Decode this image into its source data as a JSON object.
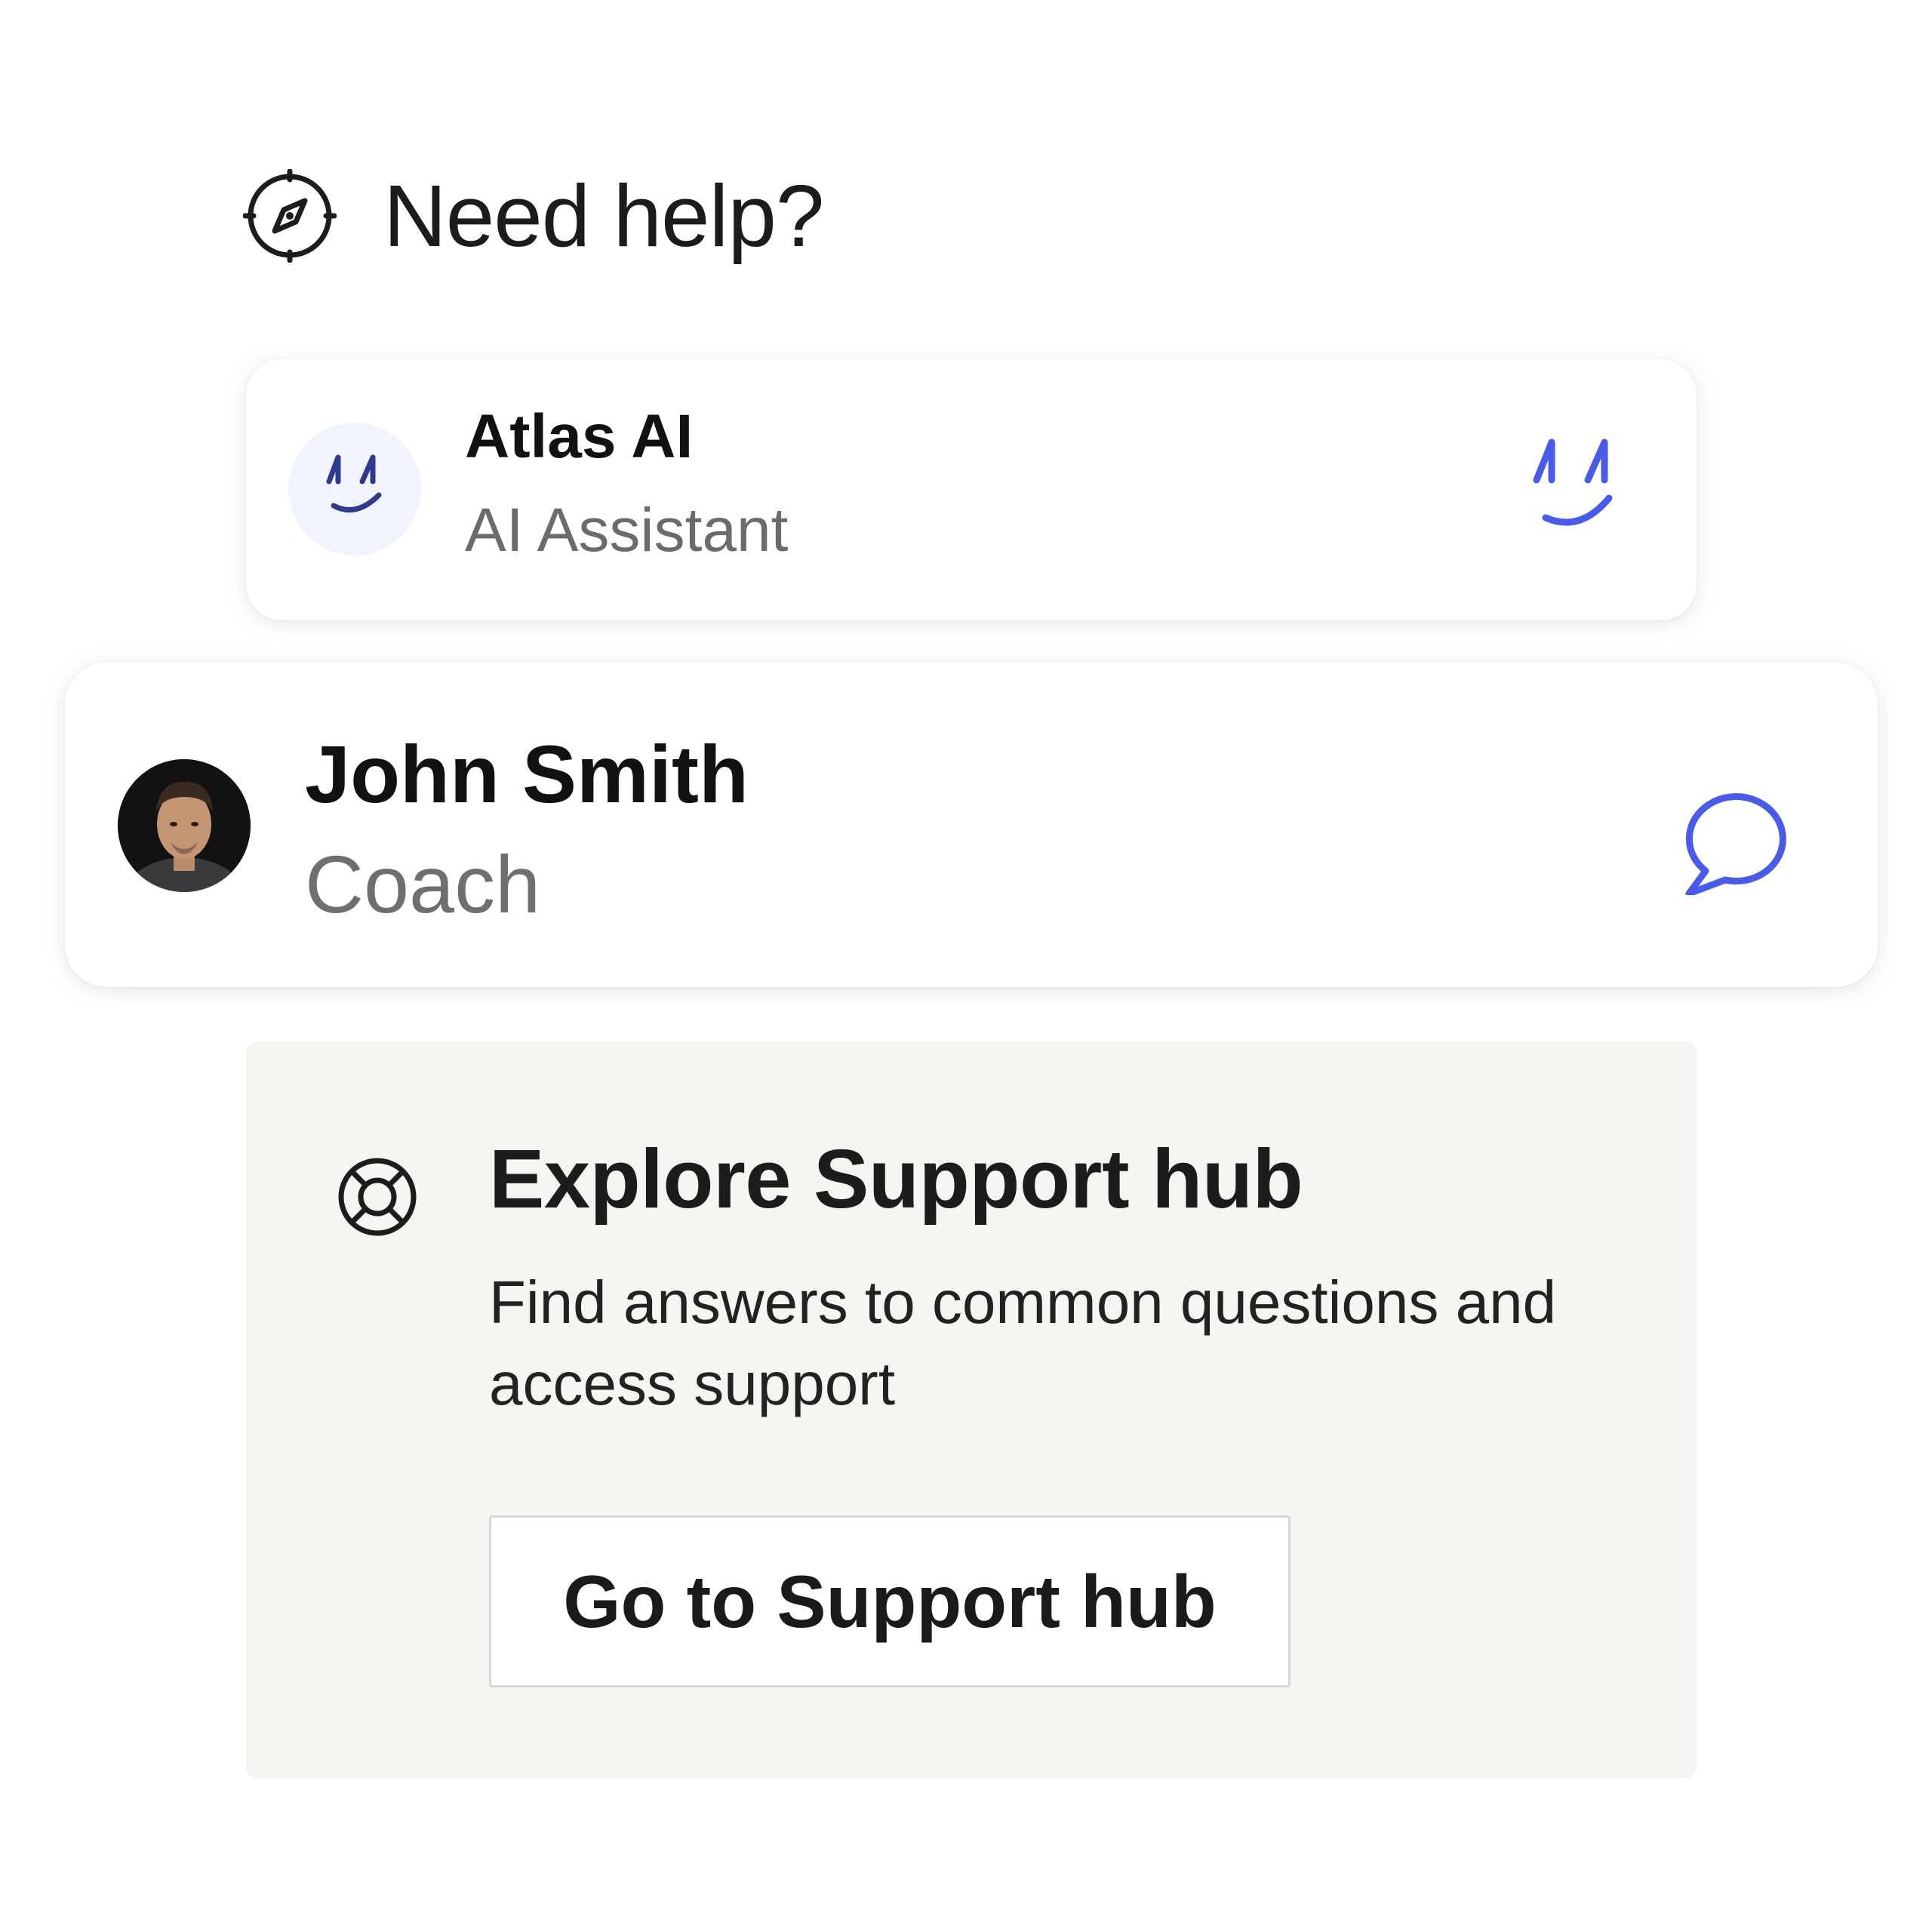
{
  "header": {
    "icon": "compass-icon",
    "title": "Need help?"
  },
  "ai_card": {
    "name": "Atlas AI",
    "role": "AI Assistant",
    "avatar_icon": "atlas-ai-logo-icon",
    "action_icon": "atlas-ai-logo-icon",
    "accent_color": "#4a5be8",
    "logo_dark_color": "#2f3a8f"
  },
  "coach_card": {
    "name": "John Smith",
    "role": "Coach",
    "avatar": "coach-photo",
    "action_icon": "chat-bubble-icon",
    "accent_color": "#4a5be8"
  },
  "support": {
    "icon": "lifebuoy-icon",
    "title": "Explore Support hub",
    "description": "Find answers to common questions and access support",
    "button_label": "Go to Support hub",
    "background_color": "#f6f5f2"
  }
}
